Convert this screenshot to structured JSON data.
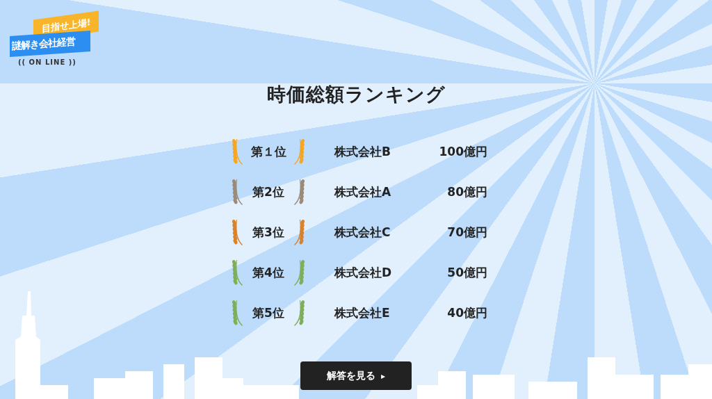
{
  "logo": {
    "tagline": "目指せ上場!",
    "name": "謎解き会社経営",
    "subtitle": "(( ON LINE ))"
  },
  "title": "時価総額ランキング",
  "rankings": [
    {
      "rank": "第１位",
      "company": "株式会社B",
      "value": "100億円",
      "color": "#f5a623"
    },
    {
      "rank": "第2位",
      "company": "株式会社A",
      "value": "80億円",
      "color": "#9a8a78"
    },
    {
      "rank": "第3位",
      "company": "株式会社C",
      "value": "70億円",
      "color": "#d9822b"
    },
    {
      "rank": "第4位",
      "company": "株式会社D",
      "value": "50億円",
      "color": "#7fae5a"
    },
    {
      "rank": "第5位",
      "company": "株式会社E",
      "value": "40億円",
      "color": "#7fae5a"
    }
  ],
  "button": {
    "label": "解答を見る",
    "icon": "▸"
  }
}
